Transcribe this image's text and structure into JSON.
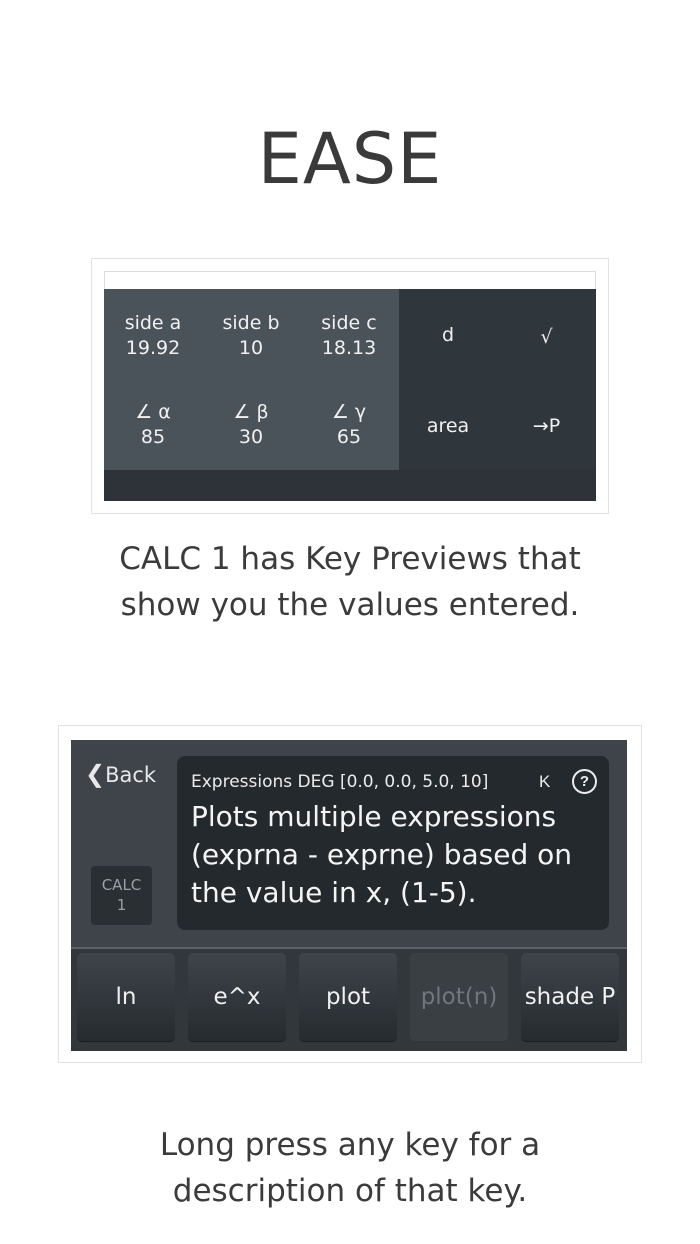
{
  "title": "EASE",
  "key_previews": {
    "cells": [
      {
        "label": "side a",
        "value": "19.92"
      },
      {
        "label": "side b",
        "value": "10"
      },
      {
        "label": "side c",
        "value": "18.13"
      },
      {
        "label": "d"
      },
      {
        "label": "√"
      },
      {
        "label": "∠ α",
        "value": "85"
      },
      {
        "label": "∠ β",
        "value": "30"
      },
      {
        "label": "∠ γ",
        "value": "65"
      },
      {
        "label": "area"
      },
      {
        "label": "→P"
      }
    ]
  },
  "caption_1": {
    "line1": "CALC 1 has Key Previews that",
    "line2": "show you the values entered."
  },
  "calc": {
    "back_label": "Back",
    "badge_line1": "CALC",
    "badge_line2": "1",
    "description": {
      "header": "Expressions DEG [0.0, 0.0, 5.0, 10]",
      "k_label": "K",
      "help_label": "?",
      "line1": "Plots multiple expressions",
      "line2": "(exprna - exprne) based on",
      "line3": "the value in x, (1-5)."
    },
    "keys": [
      "ln",
      "e^x",
      "plot",
      "plot(n)",
      "shade P"
    ]
  },
  "caption_2": {
    "line1": "Long press any key for a",
    "line2": "description of that key."
  },
  "colors": {
    "panel_dark": "#2f363c",
    "panel_light": "#4b535a",
    "key_text": "#f0f0f0",
    "disabled_key_text": "#70767b"
  }
}
